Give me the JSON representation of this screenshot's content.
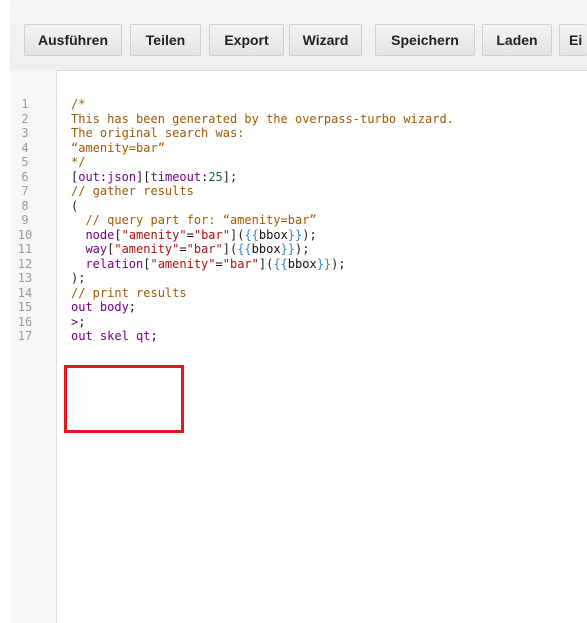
{
  "toolbar": {
    "buttons": [
      {
        "label": "Ausführen"
      },
      {
        "label": "Teilen"
      },
      {
        "label": "Export"
      },
      {
        "label": "Wizard"
      },
      {
        "label": "Speichern"
      },
      {
        "label": "Laden"
      },
      {
        "label": "Ei"
      }
    ]
  },
  "editor": {
    "line_numbers": [
      "1",
      "2",
      "3",
      "4",
      "5",
      "6",
      "7",
      "8",
      "9",
      "10",
      "11",
      "12",
      "13",
      "14",
      "15",
      "16",
      "17"
    ],
    "lines": [
      {
        "tokens": [
          {
            "t": "/*",
            "c": "comment"
          }
        ]
      },
      {
        "tokens": [
          {
            "t": "This has been generated by the overpass-turbo wizard.",
            "c": "comment"
          }
        ]
      },
      {
        "tokens": [
          {
            "t": "The original search was:",
            "c": "comment"
          }
        ]
      },
      {
        "tokens": [
          {
            "t": "“amenity=bar”",
            "c": "comment"
          }
        ]
      },
      {
        "tokens": [
          {
            "t": "*/",
            "c": "comment"
          }
        ]
      },
      {
        "tokens": [
          {
            "t": "[",
            "c": "bracket"
          },
          {
            "t": "out",
            "c": "kw"
          },
          {
            "t": ":",
            "c": "plain"
          },
          {
            "t": "json",
            "c": "kw"
          },
          {
            "t": "][",
            "c": "bracket"
          },
          {
            "t": "timeout",
            "c": "kw"
          },
          {
            "t": ":",
            "c": "plain"
          },
          {
            "t": "25",
            "c": "num"
          },
          {
            "t": "];",
            "c": "bracket"
          }
        ]
      },
      {
        "tokens": [
          {
            "t": "// gather results",
            "c": "comment"
          }
        ]
      },
      {
        "tokens": [
          {
            "t": "(",
            "c": "bracket"
          }
        ]
      },
      {
        "tokens": [
          {
            "t": "  // query part for: “amenity=bar”",
            "c": "comment"
          }
        ]
      },
      {
        "tokens": [
          {
            "t": "  node",
            "c": "kw"
          },
          {
            "t": "[",
            "c": "bracket"
          },
          {
            "t": "\"amenity\"",
            "c": "str"
          },
          {
            "t": "=",
            "c": "plain"
          },
          {
            "t": "\"bar\"",
            "c": "str"
          },
          {
            "t": "](",
            "c": "bracket"
          },
          {
            "t": "{{",
            "c": "tpl"
          },
          {
            "t": "bbox",
            "c": "plain"
          },
          {
            "t": "}}",
            "c": "tpl"
          },
          {
            "t": ");",
            "c": "bracket"
          }
        ]
      },
      {
        "tokens": [
          {
            "t": "  way",
            "c": "kw"
          },
          {
            "t": "[",
            "c": "bracket"
          },
          {
            "t": "\"amenity\"",
            "c": "str"
          },
          {
            "t": "=",
            "c": "plain"
          },
          {
            "t": "\"bar\"",
            "c": "str"
          },
          {
            "t": "](",
            "c": "bracket"
          },
          {
            "t": "{{",
            "c": "tpl"
          },
          {
            "t": "bbox",
            "c": "plain"
          },
          {
            "t": "}}",
            "c": "tpl"
          },
          {
            "t": ");",
            "c": "bracket"
          }
        ]
      },
      {
        "tokens": [
          {
            "t": "  relation",
            "c": "kw"
          },
          {
            "t": "[",
            "c": "bracket"
          },
          {
            "t": "\"amenity\"",
            "c": "str"
          },
          {
            "t": "=",
            "c": "plain"
          },
          {
            "t": "\"bar\"",
            "c": "str"
          },
          {
            "t": "](",
            "c": "bracket"
          },
          {
            "t": "{{",
            "c": "tpl"
          },
          {
            "t": "bbox",
            "c": "plain"
          },
          {
            "t": "}}",
            "c": "tpl"
          },
          {
            "t": ");",
            "c": "bracket"
          }
        ]
      },
      {
        "tokens": [
          {
            "t": ");",
            "c": "bracket"
          }
        ]
      },
      {
        "tokens": [
          {
            "t": "// print results",
            "c": "comment"
          }
        ]
      },
      {
        "tokens": [
          {
            "t": "out body",
            "c": "kw"
          },
          {
            "t": ";",
            "c": "plain"
          }
        ]
      },
      {
        "tokens": [
          {
            "t": ">",
            "c": "kw"
          },
          {
            "t": ";",
            "c": "plain"
          }
        ]
      },
      {
        "tokens": [
          {
            "t": "out skel qt",
            "c": "kw"
          },
          {
            "t": ";",
            "c": "plain"
          }
        ]
      }
    ]
  },
  "highlight": {
    "color": "#e8141e"
  }
}
